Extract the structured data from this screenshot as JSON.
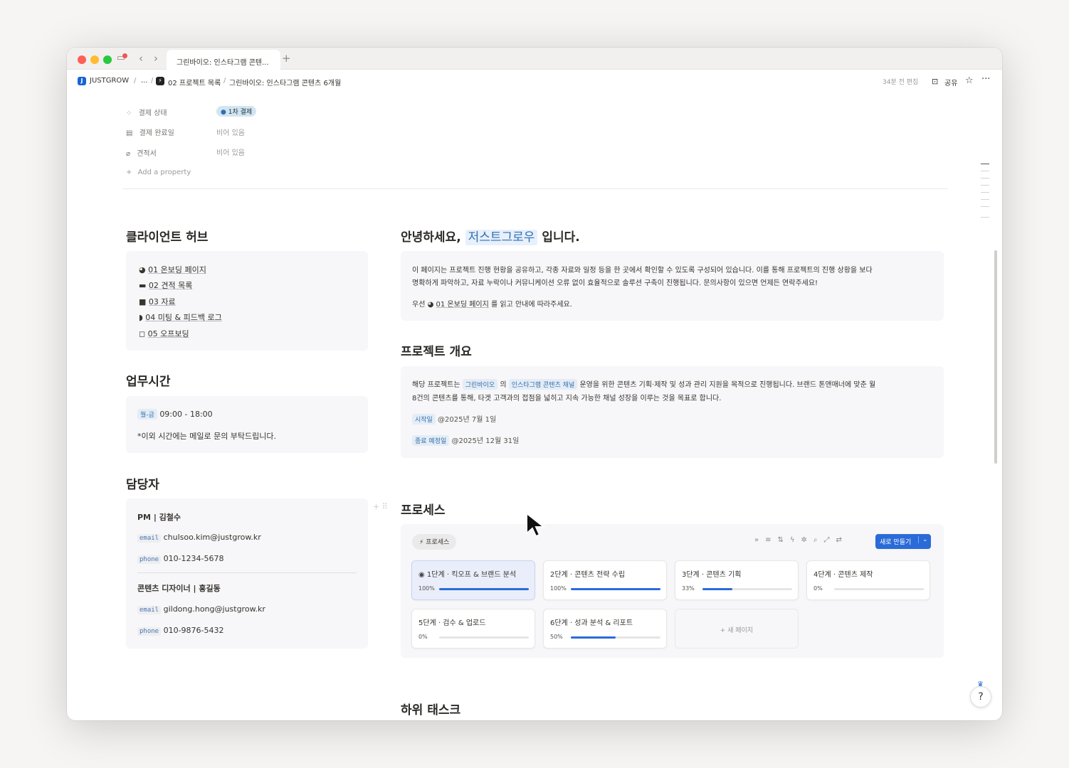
{
  "browser": {
    "tab_title": "그린바이오: 인스타그램 콘텐...",
    "new_tab": "+",
    "back": "‹",
    "forward": "›"
  },
  "breadcrumb": {
    "workspace": "JUSTGROW",
    "ellipsis": "...",
    "projects": "02 프로젝트 목록",
    "page": "그린바이오: 인스타그램 콘텐츠 6개월",
    "edited": "34분 전 편집",
    "share": "공유"
  },
  "properties": {
    "payment_status_label": "결제 상태",
    "payment_status_value": "1차 결제",
    "payment_date_label": "결제 완료일",
    "payment_date_value": "비어 있음",
    "quote_label": "견적서",
    "quote_value": "비어 있음",
    "add_property": "Add a property"
  },
  "client_hub": {
    "title": "클라이언트 허브",
    "items": [
      "01 온보딩 페이지",
      "02 견적 목록",
      "03 자료",
      "04 미팅 & 피드백 로그",
      "05 오프보딩"
    ]
  },
  "hours": {
    "title": "업무시간",
    "days": "월-금",
    "time": "09:00 - 18:00",
    "note": "*이외 시간에는 메일로 문의 부탁드립니다."
  },
  "managers": {
    "title": "담당자",
    "people": [
      {
        "role": "PM | 김철수",
        "email_label": "email",
        "email": "chulsoo.kim@justgrow.kr",
        "phone_label": "phone",
        "phone": "010-1234-5678"
      },
      {
        "role": "콘텐츠 디자이너 | 홍길동",
        "email_label": "email",
        "email": "gildong.hong@justgrow.kr",
        "phone_label": "phone",
        "phone": "010-9876-5432"
      }
    ]
  },
  "greeting": {
    "prefix": "안녕하세요,",
    "name": "저스트그로우",
    "suffix": "입니다.",
    "body1": "이 페이지는 프로젝트 진행 현황을 공유하고, 각종 자료와 일정 등을 한 곳에서 확인할 수 있도록 구성되어 있습니다. 이를 통해 프로젝트의 진행 상황을 보다",
    "body2": "명확하게 파악하고, 자료 누락이나 커뮤니케이션 오류 없이 효율적으로 솔루션 구축이 진행됩니다. 문의사항이 있으면 언제든 연락주세요!",
    "first_prefix": "우선",
    "first_link": "01 온보딩 페이지",
    "first_suffix": "를 읽고 안내에 따라주세요."
  },
  "overview": {
    "title": "프로젝트 개요",
    "l1_a": "해당 프로젝트는",
    "l1_tag1": "그린바이오",
    "l1_b": "의",
    "l1_tag2": "인스타그램 콘텐츠 채널",
    "l1_c": "운영을 위한 콘텐츠 기획·제작 및 성과 관리 지원을 목적으로 진행됩니다. 브랜드 톤앤매너에 맞춘 월",
    "l2": "8건의 콘텐츠를 통해, 타겟 고객과의 접점을 넓히고 지속 가능한 채널 성장을 이루는 것을 목표로 합니다.",
    "start_label": "시작일",
    "start_date": "@2025년 7월 1일",
    "end_label": "종료 예정일",
    "end_date": "@2025년 12월 31일"
  },
  "process": {
    "title": "프로세스",
    "view_label": "프로세스",
    "new_button": "새로 만들기",
    "add_page": "+ 새 페이지",
    "steps": [
      {
        "title": "1단계 · 킥오프 & 브랜드 분석",
        "pct_label": "100%",
        "progress": 1.0
      },
      {
        "title": "2단계 · 콘텐츠 전략 수립",
        "pct_label": "100%",
        "progress": 1.0
      },
      {
        "title": "3단계 · 콘텐츠 기획",
        "pct_label": "33%",
        "progress": 0.33
      },
      {
        "title": "4단계 · 콘텐츠 제작",
        "pct_label": "0%",
        "progress": 0.0
      },
      {
        "title": "5단계 · 검수 & 업로드",
        "pct_label": "0%",
        "progress": 0.0
      },
      {
        "title": "6단계 · 성과 분석 & 리포트",
        "pct_label": "50%",
        "progress": 0.5
      }
    ]
  },
  "subtasks": {
    "title": "하위 태스크"
  },
  "help": {
    "label": "?"
  }
}
